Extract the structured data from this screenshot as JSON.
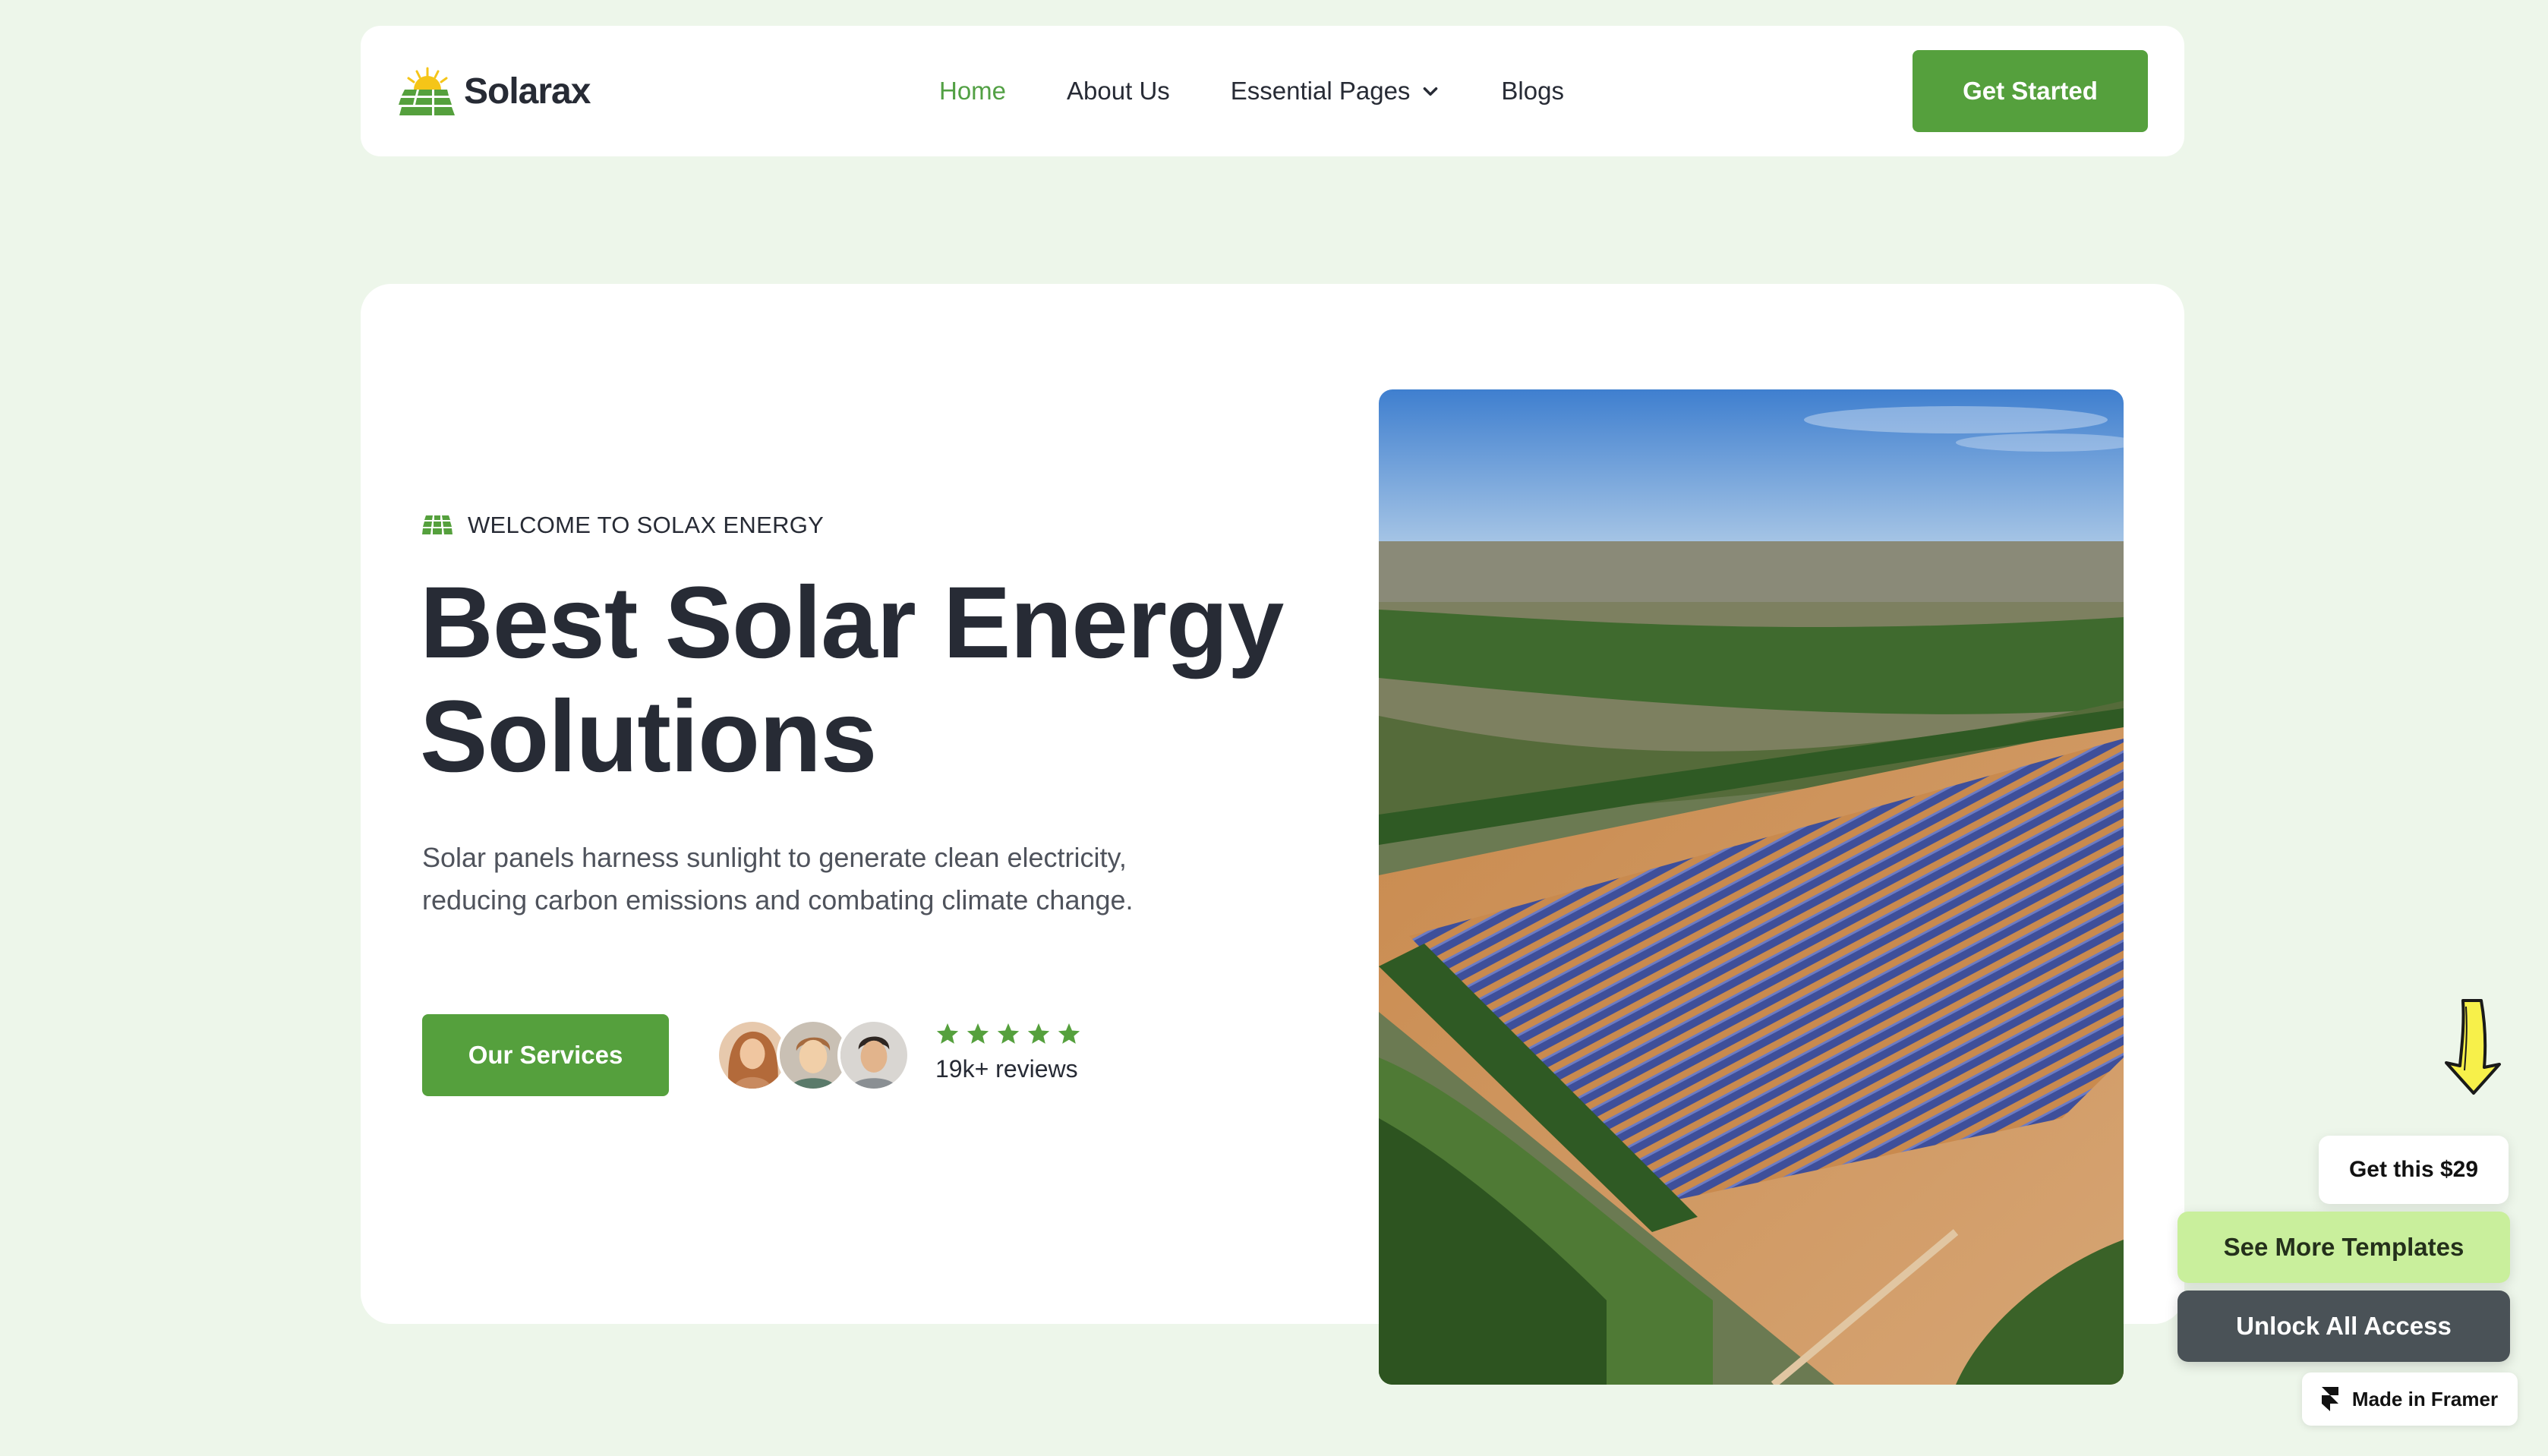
{
  "nav": {
    "brand": "Solarax",
    "links": [
      {
        "label": "Home",
        "active": true
      },
      {
        "label": "About Us",
        "active": false
      },
      {
        "label": "Essential Pages",
        "active": false,
        "has_dropdown": true
      },
      {
        "label": "Blogs",
        "active": false
      }
    ],
    "cta_label": "Get Started"
  },
  "hero": {
    "eyebrow": "WELCOME TO SOLAX ENERGY",
    "headline_line1": "Best Solar Energy",
    "headline_line2": "Solutions",
    "description_line1": "Solar panels harness sunlight to generate clean electricity,",
    "description_line2": "reducing carbon emissions and combating climate change.",
    "cta_label": "Our Services",
    "rating_stars": 5,
    "reviews_label": "19k+ reviews"
  },
  "widgets": {
    "get_this_label": "Get this $29",
    "more_templates_label": "See More Templates",
    "unlock_label": "Unlock All Access",
    "framer_badge_label": "Made in Framer"
  },
  "colors": {
    "page_bg": "#edf6ea",
    "brand_green": "#55a03d",
    "nav_active": "#52a044",
    "text_dark": "#272b35",
    "lime": "#c9ef9c",
    "slate": "#4a5257"
  },
  "icons": {
    "logo": "solar-panel-sun-icon",
    "eyebrow": "solar-panel-icon",
    "dropdown": "chevron-down-icon",
    "star": "star-icon",
    "arrow": "arrow-down-icon",
    "framer": "framer-logo-icon"
  }
}
